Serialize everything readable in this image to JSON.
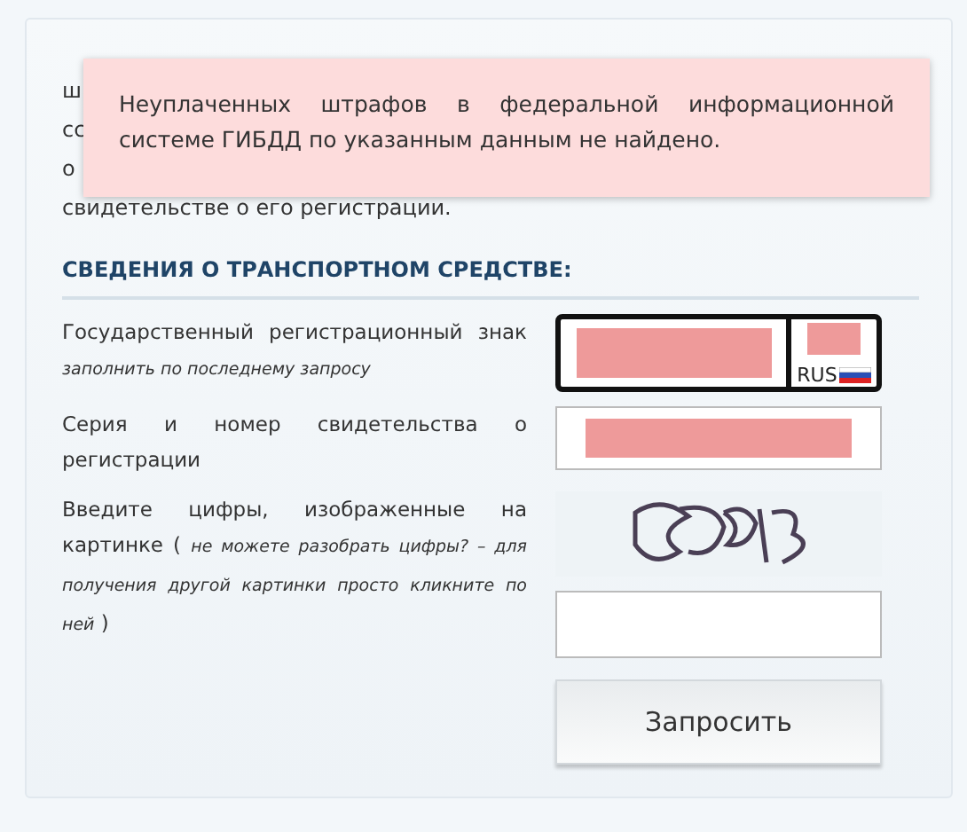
{
  "intro_lines": [
    "ш",
    "сс",
    "о",
    "свидетельстве о его регистрации."
  ],
  "alert": {
    "message": "Неуплаченных штрафов в федеральной информационной системе ГИБДД по указанным данным не найдено."
  },
  "section_title": "СВЕДЕНИЯ О ТРАНСПОРТНОМ СРЕДСТВЕ:",
  "fields": [
    {
      "kind": "plate",
      "label": "Государственный регистрационный знак",
      "hint": "заполнить по последнему запросу",
      "region_label": "RUS",
      "redacted": true
    },
    {
      "kind": "text",
      "label": "Серия и номер свидетельства о регистрации",
      "redacted": true
    },
    {
      "kind": "captcha",
      "label": "Введите цифры, изображенные на картинке (",
      "hint": "не можете разобрать цифры? – для получения другой картинки просто кликните по ней",
      "closing": ")"
    }
  ],
  "submit_button": "Запросить"
}
